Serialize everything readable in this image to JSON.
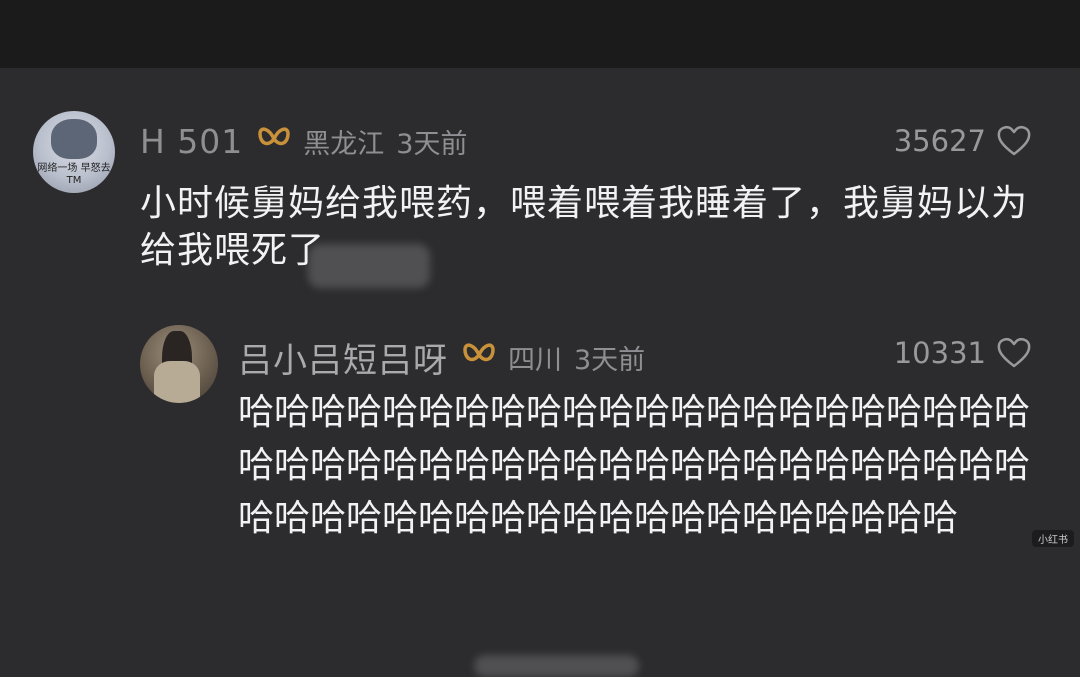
{
  "comments": [
    {
      "username": "H         501",
      "location": "黑龙江",
      "time": "3天前",
      "likes": "35627",
      "text": "小时候舅妈给我喂药，喂着喂着我睡着了，我舅妈以为给我喂死了",
      "avatar_caption": "网络一场 早怒去TM"
    },
    {
      "username": "吕小吕短吕呀",
      "location": "四川",
      "time": "3天前",
      "likes": "10331",
      "text": "哈哈哈哈哈哈哈哈哈哈哈哈哈哈哈哈哈哈哈哈哈哈哈哈哈哈哈哈哈哈哈哈哈哈哈哈哈哈哈哈哈哈哈哈哈哈哈哈哈哈哈哈哈哈哈哈哈哈哈哈哈哈哈哈"
    }
  ],
  "watermark": "小红书",
  "colors": {
    "background": "#2c2c2e",
    "topbar": "#1b1b1c",
    "badge": "#c9923a",
    "meta_text": "#8e8e93",
    "body_text": "#f2f2f4"
  },
  "icons": {
    "badge": "butterfly-icon",
    "like": "heart-outline-icon"
  }
}
